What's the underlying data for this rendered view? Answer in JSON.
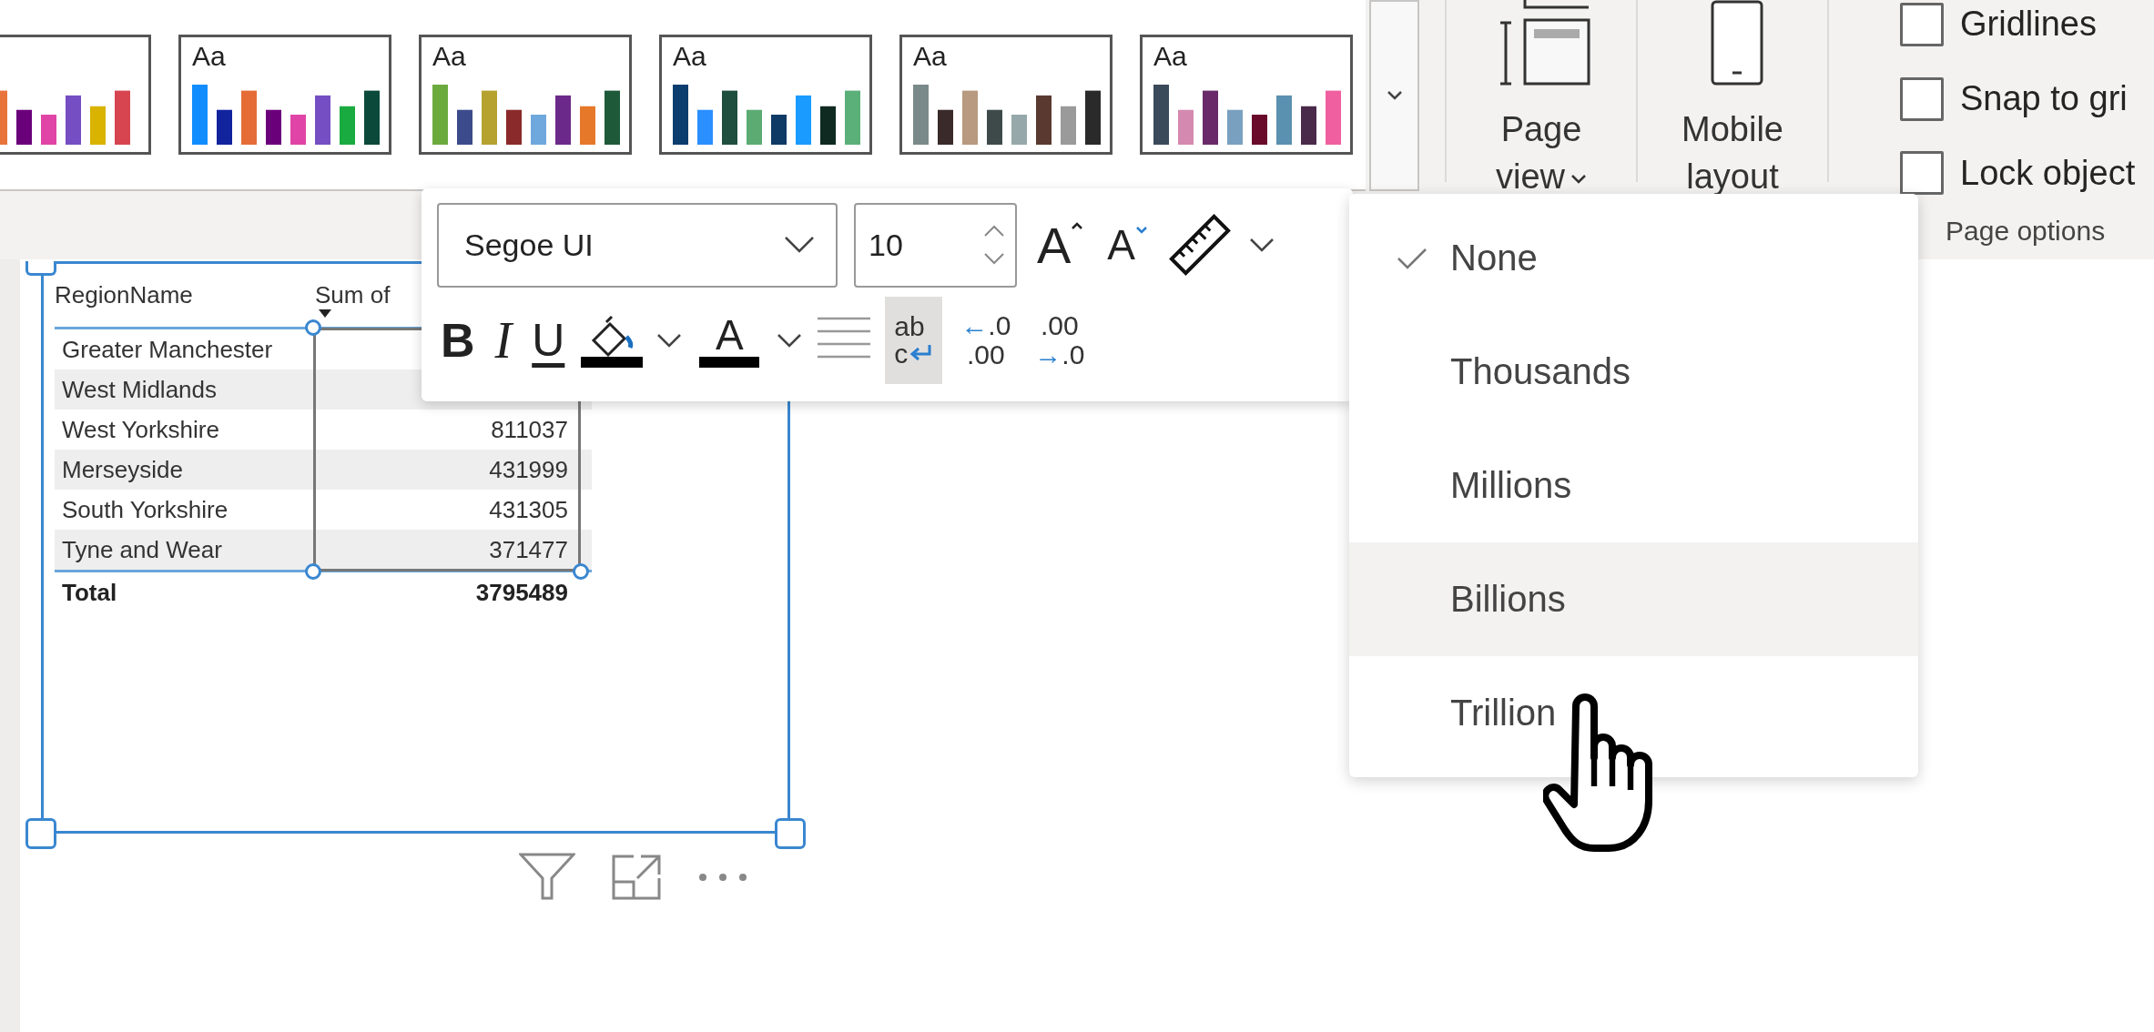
{
  "ribbon": {
    "themes": [
      {
        "label": "Aa"
      },
      {
        "label": "Aa"
      },
      {
        "label": "Aa"
      },
      {
        "label": "Aa"
      },
      {
        "label": "Aa"
      }
    ],
    "view_buttons": [
      {
        "kind": "page-view",
        "label": "Page view",
        "dropdown": true
      },
      {
        "kind": "mobile",
        "label": "Mobile layout",
        "dropdown": false
      }
    ],
    "page_options": {
      "checkboxes": [
        {
          "label": "Gridlines",
          "checked": false
        },
        {
          "label": "Snap to gri",
          "checked": false
        },
        {
          "label": "Lock object",
          "checked": false
        }
      ],
      "label": "Page options"
    }
  },
  "visual": {
    "table": {
      "columns": [
        "RegionName",
        "Sum of"
      ],
      "rows": [
        {
          "name": "Greater Manchester"
        },
        {
          "name": "West Midlands"
        },
        {
          "name": "West Yorkshire",
          "value": "811037"
        },
        {
          "name": "Merseyside",
          "value": "431999"
        },
        {
          "name": "South Yorkshire",
          "value": "431305"
        },
        {
          "name": "Tyne and Wear",
          "value": "371477"
        }
      ],
      "total": {
        "label": "Total",
        "value": "3795489"
      }
    }
  },
  "format_toolbar": {
    "font": "Segoe UI",
    "size": "10",
    "grow_font": "A",
    "shrink_font": "A",
    "bold": "B",
    "italic": "I",
    "underline": "U",
    "font_color": "A",
    "wrap_text": {
      "top": "ab",
      "bottom": "c",
      "selected": true
    },
    "decimals": [
      {
        "arrow": "←",
        "top": ".0",
        "bottom": ".00",
        "arrow_on_top": true
      },
      {
        "arrow": "→",
        "top": ".00",
        "bottom": ".0",
        "arrow_on_top": false
      }
    ]
  },
  "display_units_menu": {
    "items": [
      {
        "label": "None",
        "checked": true,
        "highlighted": false
      },
      {
        "label": "Thousands",
        "checked": false,
        "highlighted": false
      },
      {
        "label": "Millions",
        "checked": false,
        "highlighted": false
      },
      {
        "label": "Billions",
        "checked": false,
        "highlighted": true
      },
      {
        "label": "Trillion",
        "checked": false,
        "highlighted": false
      }
    ]
  }
}
